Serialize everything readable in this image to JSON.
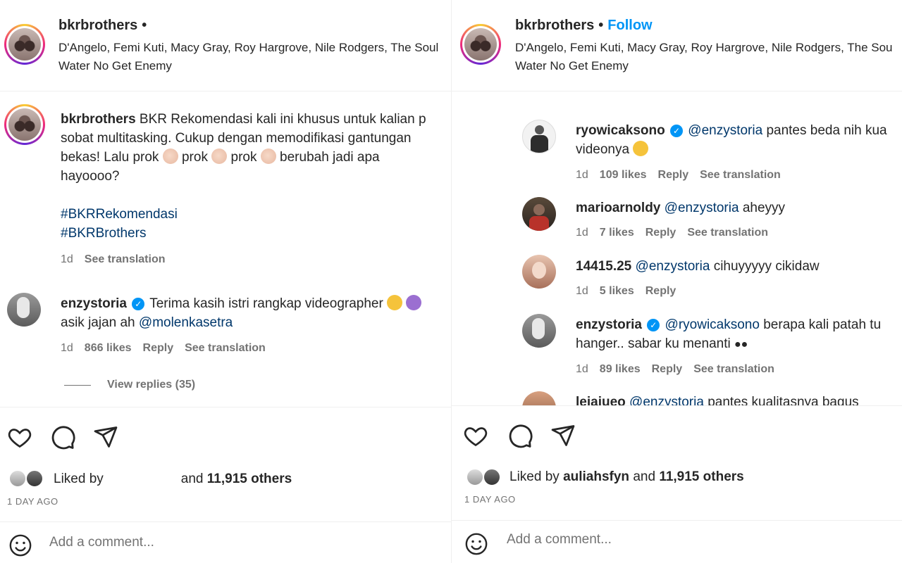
{
  "left": {
    "header": {
      "username": "bkrbrothers",
      "dot": "•",
      "music_line1": "D'Angelo, Femi Kuti, Macy Gray, Roy Hargrove, Nile Rodgers, The Soul",
      "music_line2": "Water No Get Enemy"
    },
    "caption": {
      "username": "bkrbrothers",
      "text_line1": "BKR Rekomendasi kali ini khusus untuk kalian p",
      "text_line2": "sobat multitasking. Cukup dengan memodifikasi gantungan",
      "text_line3_a": "bekas! Lalu prok",
      "text_line3_b": "prok",
      "text_line3_c": "prok",
      "text_line3_d": "berubah jadi apa",
      "text_line4": "hayoooo?",
      "hashtag1": "#BKRRekomendasi",
      "hashtag2": "#BKRBrothers",
      "time": "1d",
      "see_translation": "See translation"
    },
    "comment": {
      "username": "enzystoria",
      "text_line1": "Terima kasih istri rangkap videographer",
      "text_line2_a": "asik jajan ah",
      "mention": "@molenkasetra",
      "time": "1d",
      "likes": "866 likes",
      "reply": "Reply",
      "see_translation": "See translation",
      "view_replies": "View replies (35)"
    },
    "actions": {
      "liked_by_prefix": "Liked by",
      "liked_by_suffix_and": "and",
      "liked_by_count": "11,915 others",
      "time_ago": "1 DAY AGO",
      "add_comment": "Add a comment..."
    }
  },
  "right": {
    "header": {
      "username": "bkrbrothers",
      "dot": "•",
      "follow": "Follow",
      "music_line1": "D'Angelo, Femi Kuti, Macy Gray, Roy Hargrove, Nile Rodgers, The Sou",
      "music_line2": "Water No Get Enemy"
    },
    "comments": [
      {
        "username": "ryowicaksono",
        "mention": "@enzystoria",
        "text_a": "pantes beda nih kua",
        "text_b": "videonya",
        "time": "1d",
        "likes": "109 likes",
        "reply": "Reply",
        "see_translation": "See translation"
      },
      {
        "username": "marioarnoldy",
        "mention": "@enzystoria",
        "text_a": "aheyyy",
        "time": "1d",
        "likes": "7 likes",
        "reply": "Reply",
        "see_translation": "See translation"
      },
      {
        "username": "14415.25",
        "mention": "@enzystoria",
        "text_a": "cihuyyyyy cikidaw",
        "time": "1d",
        "likes": "5 likes",
        "reply": "Reply"
      },
      {
        "username": "enzystoria",
        "mention": "@ryowicaksono",
        "text_a": "berapa kali patah tu",
        "text_b": "hanger.. sabar ku menanti",
        "time": "1d",
        "likes": "89 likes",
        "reply": "Reply",
        "see_translation": "See translation"
      },
      {
        "username": "leiaiueo",
        "mention": "@enzystoria",
        "text_a": "pantes kualitasnya bagus"
      }
    ],
    "actions": {
      "liked_by_prefix": "Liked by",
      "liked_by_user": "auliahsfyn",
      "liked_by_and": "and",
      "liked_by_count": "11,915 others",
      "time_ago": "1 DAY AGO",
      "add_comment": "Add a comment..."
    }
  },
  "icons": {
    "like": "heart-icon",
    "comment": "comment-bubble-icon",
    "share": "paper-plane-icon",
    "emoji": "smiley-icon",
    "verified": "verified-badge-icon"
  },
  "colors": {
    "link": "#00376b",
    "follow": "#0095f6",
    "verified": "#0095f6",
    "muted": "#737373"
  }
}
